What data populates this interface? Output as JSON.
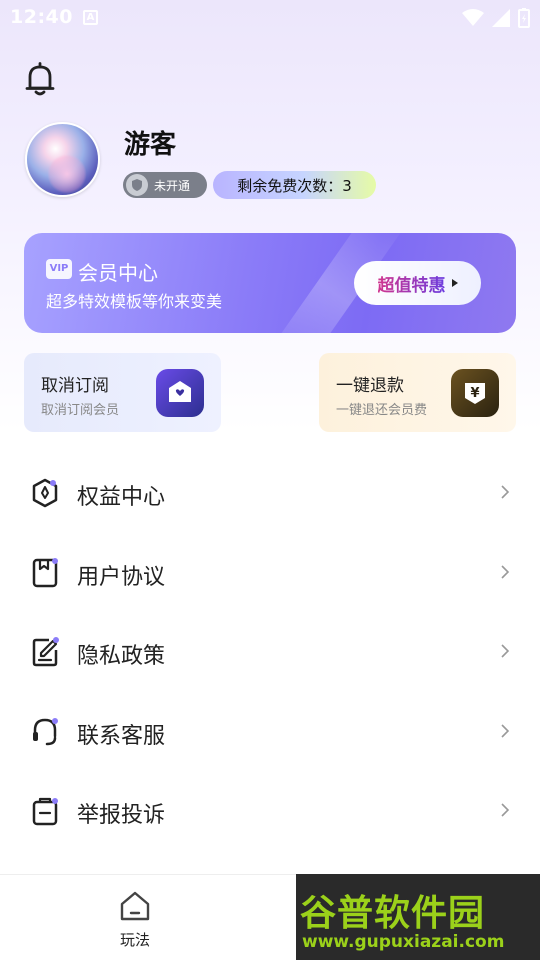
{
  "status_bar": {
    "time": "12:40",
    "notif_glyph": "A"
  },
  "header": {
    "username": "游客",
    "member_status": "未开通",
    "free_uses": "剩余免费次数：3"
  },
  "vip_card": {
    "badge": "VIP",
    "title": "会员中心",
    "subtitle": "超多特效模板等你来变美",
    "button": "超值特惠"
  },
  "quick_actions": [
    {
      "title": "取消订阅",
      "subtitle": "取消订阅会员"
    },
    {
      "title": "一键退款",
      "subtitle": "一键退还会员费",
      "icon_glyph": "¥"
    }
  ],
  "menu": [
    {
      "label": "权益中心"
    },
    {
      "label": "用户协议"
    },
    {
      "label": "隐私政策"
    },
    {
      "label": "联系客服"
    },
    {
      "label": "举报投诉"
    }
  ],
  "tabbar": {
    "play_label": "玩法"
  },
  "watermark": {
    "title": "谷普软件园",
    "url": "www.gupuxiazai.com"
  },
  "colors": {
    "accent": "#8b7cf8",
    "refund": "#fdf1dc",
    "cancel": "#e6eafc"
  }
}
